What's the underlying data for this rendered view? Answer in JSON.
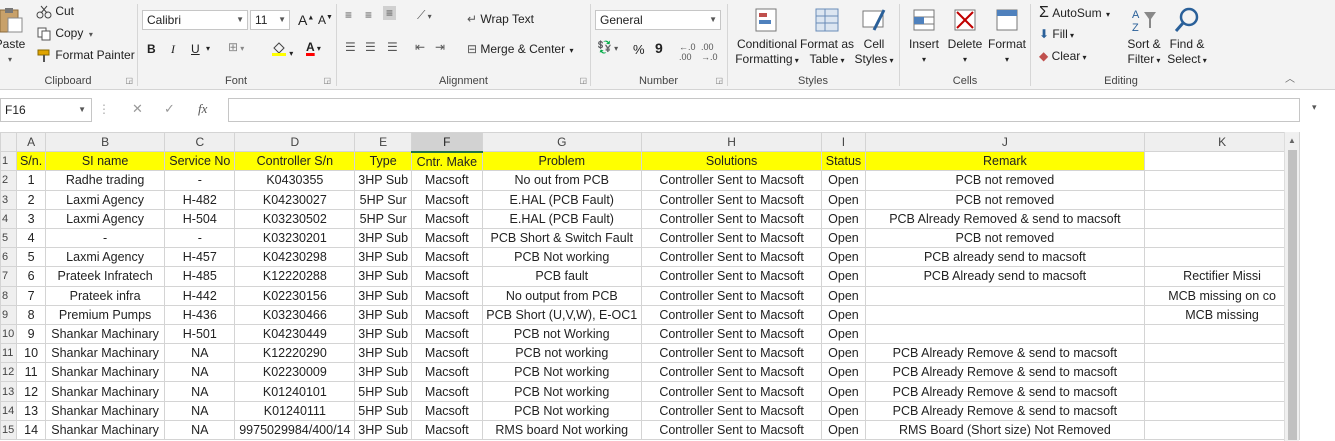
{
  "ribbon": {
    "clipboard": {
      "paste": "Paste",
      "cut": "Cut",
      "copy": "Copy",
      "format_painter": "Format Painter",
      "label": "Clipboard"
    },
    "font": {
      "name": "Calibri",
      "size": "11",
      "bold": "B",
      "italic": "I",
      "underline": "U",
      "grow": "A",
      "shrink": "A",
      "label": "Font",
      "font_color": "#ff0000",
      "fill_color": "#ffff00"
    },
    "alignment": {
      "wrap_text": "Wrap Text",
      "merge_center": "Merge & Center",
      "label": "Alignment"
    },
    "number": {
      "format": "General",
      "percent": "%",
      "comma": "9",
      "label": "Number"
    },
    "styles": {
      "conditional": "Conditional",
      "formatting": "Formatting",
      "format_as": "Format as",
      "table": "Table",
      "cell": "Cell",
      "styles": "Styles",
      "label": "Styles"
    },
    "cells": {
      "insert": "Insert",
      "delete": "Delete",
      "format": "Format",
      "label": "Cells"
    },
    "editing": {
      "autosum": "AutoSum",
      "fill": "Fill",
      "clear": "Clear",
      "sort": "Sort &",
      "filter": "Filter",
      "find": "Find &",
      "select": "Select",
      "label": "Editing"
    }
  },
  "formula_bar": {
    "name_box": "F16",
    "cancel": "✕",
    "enter": "✓",
    "fx": "fx",
    "value": ""
  },
  "sheet": {
    "columns": [
      "A",
      "B",
      "C",
      "D",
      "E",
      "F",
      "G",
      "H",
      "I",
      "J",
      "K"
    ],
    "selected_column": "F",
    "row_numbers": [
      "1",
      "2",
      "3",
      "4",
      "5",
      "6",
      "7",
      "8",
      "9",
      "10",
      "11",
      "12",
      "13",
      "14",
      "15"
    ],
    "header": [
      "S/n.",
      "SI name",
      "Service No",
      "Controller S/n",
      "Type",
      "Cntr. Make",
      "Problem",
      "Solutions",
      "Status",
      "Remark",
      ""
    ],
    "rows": [
      [
        "1",
        "Radhe trading",
        "-",
        "K0430355",
        "3HP Sub",
        "Macsoft",
        "No out from PCB",
        "Controller Sent to Macsoft",
        "Open",
        "PCB not removed",
        ""
      ],
      [
        "2",
        "Laxmi Agency",
        "H-482",
        "K04230027",
        "5HP Sur",
        "Macsoft",
        "E.HAL (PCB Fault)",
        "Controller Sent to Macsoft",
        "Open",
        "PCB not removed",
        ""
      ],
      [
        "3",
        "Laxmi Agency",
        "H-504",
        "K03230502",
        "5HP Sur",
        "Macsoft",
        "E.HAL (PCB Fault)",
        "Controller Sent to Macsoft",
        "Open",
        "PCB Already Removed & send to macsoft",
        ""
      ],
      [
        "4",
        "-",
        "-",
        "K03230201",
        "3HP Sub",
        "Macsoft",
        "PCB Short & Switch Fault",
        "Controller Sent to Macsoft",
        "Open",
        "PCB not removed",
        ""
      ],
      [
        "5",
        "Laxmi Agency",
        "H-457",
        "K04230298",
        "3HP Sub",
        "Macsoft",
        "PCB Not working",
        "Controller Sent to Macsoft",
        "Open",
        "PCB already send to macsoft",
        ""
      ],
      [
        "6",
        "Prateek Infratech",
        "H-485",
        "K12220288",
        "3HP Sub",
        "Macsoft",
        "PCB fault",
        "Controller Sent to Macsoft",
        "Open",
        "PCB Already send to macsoft",
        "Rectifier Missi"
      ],
      [
        "7",
        "Prateek infra",
        "H-442",
        "K02230156",
        "3HP  Sub",
        "Macsoft",
        "No output from PCB",
        "Controller Sent to Macsoft",
        "Open",
        "",
        "MCB missing on co"
      ],
      [
        "8",
        "Premium Pumps",
        "H-436",
        "K03230466",
        "3HP Sub",
        "Macsoft",
        "PCB Short (U,V,W), E-OC1",
        "Controller Sent to Macsoft",
        "Open",
        "",
        "MCB missing"
      ],
      [
        "9",
        "Shankar Machinary",
        "H-501",
        "K04230449",
        "3HP Sub",
        "Macsoft",
        "PCB not Working",
        "Controller Sent to Macsoft",
        "Open",
        "",
        ""
      ],
      [
        "10",
        "Shankar Machinary",
        "NA",
        "K12220290",
        "3HP Sub",
        "Macsoft",
        "PCB not working",
        "Controller Sent to Macsoft",
        "Open",
        "PCB Already Remove & send to macsoft",
        ""
      ],
      [
        "11",
        "Shankar Machinary",
        "NA",
        "K02230009",
        "3HP Sub",
        "Macsoft",
        "PCB Not working",
        "Controller Sent to Macsoft",
        "Open",
        "PCB Already Remove & send to macsoft",
        ""
      ],
      [
        "12",
        "Shankar Machinary",
        "NA",
        "K01240101",
        "5HP Sub",
        "Macsoft",
        "PCB Not working",
        "Controller Sent to Macsoft",
        "Open",
        "PCB Already Remove & send to macsoft",
        ""
      ],
      [
        "13",
        "Shankar Machinary",
        "NA",
        "K01240111",
        "5HP Sub",
        "Macsoft",
        "PCB Not working",
        "Controller Sent to Macsoft",
        "Open",
        "PCB Already Remove & send to macsoft",
        ""
      ],
      [
        "14",
        "Shankar Machinary",
        "NA",
        "9975029984/400/14",
        "3HP Sub",
        "Macsoft",
        "RMS board Not working",
        "Controller Sent to Macsoft",
        "Open",
        "RMS Board (Short size) Not Removed",
        ""
      ]
    ]
  }
}
